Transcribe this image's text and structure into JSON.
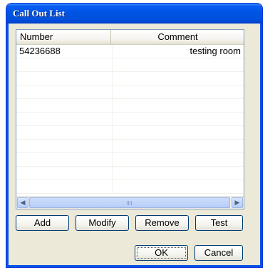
{
  "window": {
    "title": "Call Out List"
  },
  "list": {
    "columns": [
      "Number",
      "Comment"
    ],
    "rows": [
      {
        "number": "54236688",
        "comment": "testing room"
      },
      {
        "number": "",
        "comment": ""
      },
      {
        "number": "",
        "comment": ""
      },
      {
        "number": "",
        "comment": ""
      },
      {
        "number": "",
        "comment": ""
      },
      {
        "number": "",
        "comment": ""
      },
      {
        "number": "",
        "comment": ""
      },
      {
        "number": "",
        "comment": ""
      },
      {
        "number": "",
        "comment": ""
      },
      {
        "number": "",
        "comment": ""
      },
      {
        "number": "",
        "comment": ""
      }
    ]
  },
  "buttons": {
    "add": "Add",
    "modify": "Modify",
    "remove": "Remove",
    "test": "Test",
    "ok": "OK",
    "cancel": "Cancel"
  },
  "icons": {
    "scroll_left": "scroll-left-arrow-icon",
    "scroll_right": "scroll-right-arrow-icon"
  },
  "colors": {
    "title_bar": "#0054e3",
    "dialog_bg": "#ece9d8",
    "list_border": "#7f9db9"
  }
}
